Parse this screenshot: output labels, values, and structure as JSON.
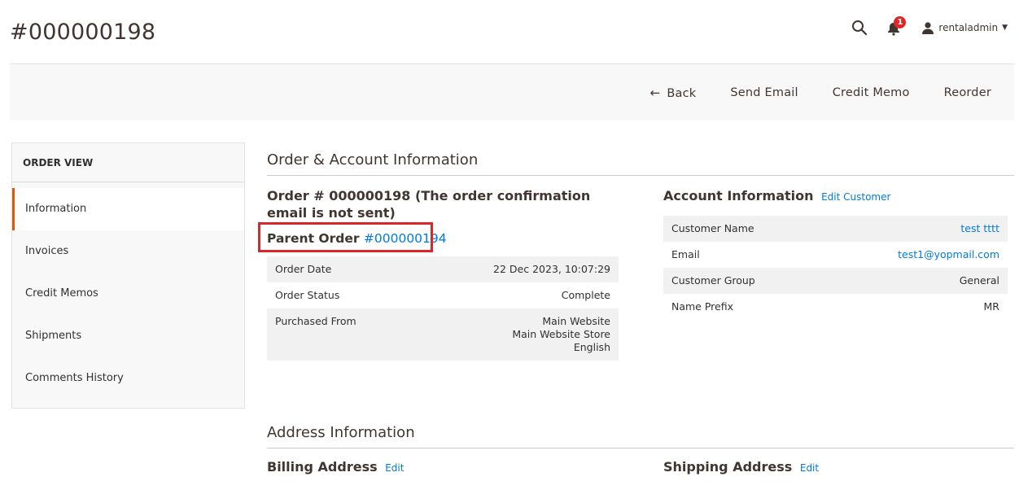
{
  "page": {
    "title": "#000000198"
  },
  "header": {
    "username": "rentaladmin",
    "notification_count": "1"
  },
  "toolbar": {
    "back": "Back",
    "send_email": "Send Email",
    "credit_memo": "Credit Memo",
    "reorder": "Reorder"
  },
  "sidebar": {
    "title": "ORDER VIEW",
    "items": [
      {
        "label": "Information"
      },
      {
        "label": "Invoices"
      },
      {
        "label": "Credit Memos"
      },
      {
        "label": "Shipments"
      },
      {
        "label": "Comments History"
      }
    ]
  },
  "order_account": {
    "section_title": "Order & Account Information",
    "order_heading": "Order # 000000198 (The order confirmation email is not sent)",
    "parent_order_label": "Parent Order",
    "parent_order_link": "#000000194",
    "order_rows": [
      {
        "label": "Order Date",
        "value": "22 Dec 2023, 10:07:29"
      },
      {
        "label": "Order Status",
        "value": "Complete"
      },
      {
        "label": "Purchased From",
        "value_lines": [
          "Main Website",
          "Main Website Store",
          "English"
        ]
      }
    ],
    "account_heading": "Account Information",
    "edit_customer": "Edit Customer",
    "account_rows": [
      {
        "label": "Customer Name",
        "value": "test tttt"
      },
      {
        "label": "Email",
        "value": "test1@yopmail.com"
      },
      {
        "label": "Customer Group",
        "value": "General"
      },
      {
        "label": "Name Prefix",
        "value": "MR"
      }
    ]
  },
  "address": {
    "section_title": "Address Information",
    "billing_heading": "Billing Address",
    "shipping_heading": "Shipping Address",
    "edit": "Edit"
  },
  "colors": {
    "accent": "#eb5202",
    "link": "#007bdb",
    "highlight": "#d9262b",
    "badge": "#e22626"
  }
}
